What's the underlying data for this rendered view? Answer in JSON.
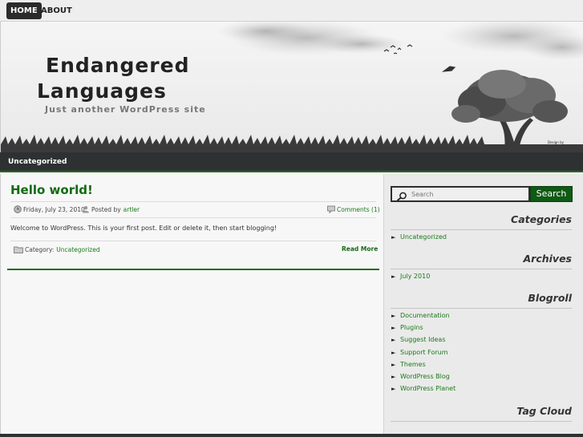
{
  "nav": {
    "items": [
      {
        "label": "HOME"
      },
      {
        "label": "ABOUT"
      }
    ]
  },
  "header": {
    "title_line1": "Endangered",
    "title_line2": "Languages",
    "tagline": "Just another WordPress site",
    "credit": "Design by"
  },
  "catbar": {
    "label": "Uncategorized"
  },
  "post": {
    "title": "Hello world!",
    "date": "Friday, July 23, 2010",
    "posted_by_label": "Posted by",
    "author": "artler",
    "comments": "Comments (1)",
    "body": "Welcome to WordPress. This is your first post. Edit or delete it, then start blogging!",
    "category_label": "Category:",
    "category": "Uncategorized",
    "read_more": "Read More"
  },
  "search": {
    "placeholder": "Search",
    "button": "Search"
  },
  "widgets": {
    "categories": {
      "title": "Categories",
      "items": [
        "Uncategorized"
      ]
    },
    "archives": {
      "title": "Archives",
      "items": [
        "July 2010"
      ]
    },
    "blogroll": {
      "title": "Blogroll",
      "items": [
        "Documentation",
        "Plugins",
        "Suggest Ideas",
        "Support Forum",
        "Themes",
        "WordPress Blog",
        "WordPress Planet"
      ]
    },
    "tagcloud": {
      "title": "Tag Cloud"
    }
  },
  "colors": {
    "accent_green": "#1c6e1c",
    "link_green": "#1a7a1a",
    "dark_bar": "#2e3132"
  }
}
